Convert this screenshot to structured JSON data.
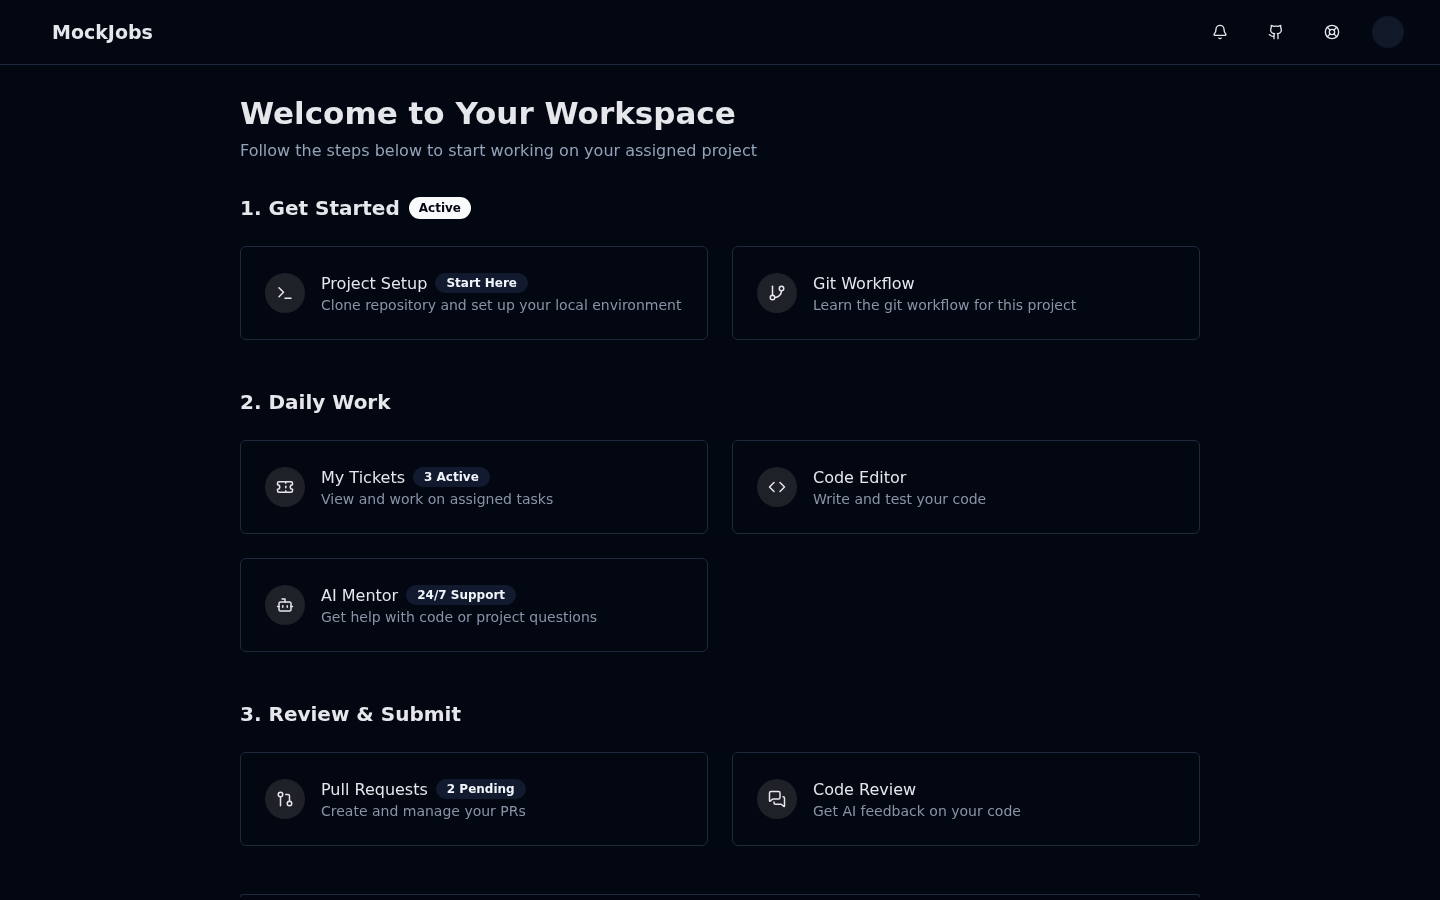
{
  "header": {
    "logo": "MockJobs"
  },
  "title": "Welcome to Your Workspace",
  "subtitle": "Follow the steps below to start working on your assigned project",
  "sections": [
    {
      "heading": "1. Get Started",
      "badge": "Active",
      "cards": [
        {
          "title": "Project Setup",
          "badge": "Start Here",
          "description": "Clone repository and set up your local environment"
        },
        {
          "title": "Git Workflow",
          "description": "Learn the git workflow for this project"
        }
      ]
    },
    {
      "heading": "2. Daily Work",
      "cards": [
        {
          "title": "My Tickets",
          "badge": "3 Active",
          "description": "View and work on assigned tasks"
        },
        {
          "title": "Code Editor",
          "description": "Write and test your code"
        },
        {
          "title": "AI Mentor",
          "badge": "24/7 Support",
          "description": "Get help with code or project questions"
        }
      ]
    },
    {
      "heading": "3. Review & Submit",
      "cards": [
        {
          "title": "Pull Requests",
          "badge": "2 Pending",
          "description": "Create and manage your PRs"
        },
        {
          "title": "Code Review",
          "description": "Get AI feedback on your code"
        }
      ]
    }
  ]
}
